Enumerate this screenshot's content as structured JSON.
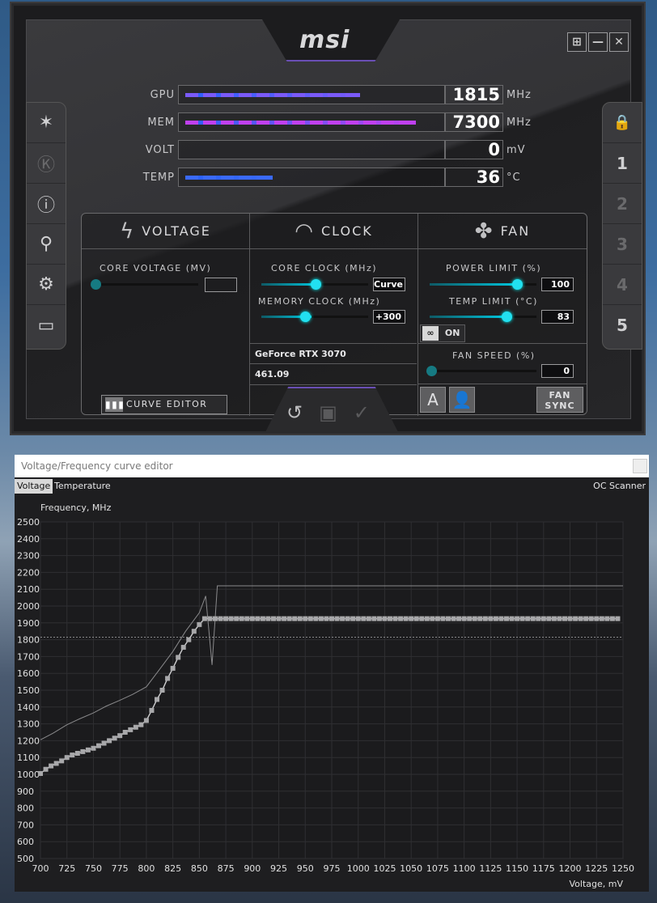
{
  "brand": "msi",
  "window_buttons": [
    "⊞",
    "—",
    "✕"
  ],
  "left_sidebar": [
    {
      "icon": "afterburner-icon",
      "glyph": "✶"
    },
    {
      "icon": "kombustor-icon",
      "glyph": "Ⓚ"
    },
    {
      "icon": "info-icon",
      "glyph": "ⓘ"
    },
    {
      "icon": "oc-scanner-icon",
      "glyph": "⚲"
    },
    {
      "icon": "settings-gear-icon",
      "glyph": "⚙"
    },
    {
      "icon": "monitor-icon",
      "glyph": "▭"
    }
  ],
  "right_sidebar": [
    {
      "icon": "lock-icon",
      "label": "🔒"
    },
    {
      "label": "1",
      "active": true
    },
    {
      "label": "2",
      "active": false
    },
    {
      "label": "3",
      "active": false
    },
    {
      "label": "4",
      "active": false
    },
    {
      "label": "5",
      "active": true
    }
  ],
  "meters": {
    "gpu": {
      "label": "GPU",
      "value": "1815",
      "unit": "MHz",
      "fill": 0.72,
      "color": "#7a5af8"
    },
    "mem": {
      "label": "MEM",
      "value": "7300",
      "unit": "MHz",
      "fill": 0.95,
      "color": "#c040f0"
    },
    "volt": {
      "label": "VOLT",
      "value": "0",
      "unit": "mV",
      "fill": 0.0,
      "color": "#3a8aff"
    },
    "temp": {
      "label": "TEMP",
      "value": "36",
      "unit": "°C",
      "fill": 0.36,
      "color": "#3a6aff"
    }
  },
  "voltage_panel": {
    "title": "VOLTAGE",
    "core_voltage_label": "CORE VOLTAGE  (MV)",
    "core_voltage_value": "",
    "curve_editor_label": "CURVE EDITOR"
  },
  "clock_panel": {
    "title": "CLOCK",
    "core_clock_label": "CORE CLOCK (MHz)",
    "core_clock_value": "Curve",
    "memory_clock_label": "MEMORY CLOCK (MHz)",
    "memory_clock_value": "+300",
    "gpu_name": "GeForce RTX 3070",
    "driver_version": "461.09"
  },
  "fan_panel": {
    "title": "FAN",
    "power_limit_label": "POWER LIMIT (%)",
    "power_limit_value": "100",
    "temp_limit_label": "TEMP LIMIT (°C)",
    "temp_limit_value": "83",
    "link_toggle_label": "ON",
    "fan_speed_label": "FAN SPEED (%)",
    "fan_speed_value": "0",
    "auto_label": "A",
    "fan_sync_label": "FAN\nSYNC"
  },
  "bottom_actions": [
    {
      "icon": "reset-icon",
      "glyph": "↺"
    },
    {
      "icon": "save-icon",
      "glyph": "▣"
    },
    {
      "icon": "apply-check-icon",
      "glyph": "✓"
    }
  ],
  "vf_editor": {
    "title": "Voltage/Frequency curve editor",
    "tabs": [
      "Voltage",
      "Temperature"
    ],
    "oc_scanner": "OC Scanner"
  },
  "chart_data": {
    "type": "line",
    "ylabel": "Frequency, MHz",
    "xlabel": "Voltage, mV",
    "xlim": [
      700,
      1250
    ],
    "ylim": [
      500,
      2500
    ],
    "x_ticks": [
      700,
      725,
      750,
      775,
      800,
      825,
      850,
      875,
      900,
      925,
      950,
      975,
      1000,
      1025,
      1050,
      1075,
      1100,
      1125,
      1150,
      1175,
      1200,
      1225,
      1250
    ],
    "y_ticks": [
      500,
      600,
      700,
      800,
      900,
      1000,
      1100,
      1200,
      1300,
      1400,
      1500,
      1600,
      1700,
      1800,
      1900,
      2000,
      2100,
      2200,
      2300,
      2400,
      2500
    ],
    "reference_line": 1815,
    "grid": true,
    "series": [
      {
        "role": "default-curve",
        "x": [
          700,
          712,
          725,
          737,
          750,
          762,
          775,
          787,
          800,
          812,
          825,
          837,
          850,
          856,
          862,
          867,
          1250
        ],
        "y": [
          1205,
          1245,
          1295,
          1330,
          1365,
          1405,
          1440,
          1475,
          1520,
          1620,
          1730,
          1850,
          1960,
          2060,
          1650,
          2120,
          2120
        ]
      },
      {
        "role": "current-curve",
        "x": [
          700,
          705,
          710,
          715,
          720,
          725,
          730,
          735,
          740,
          745,
          750,
          755,
          760,
          765,
          770,
          775,
          780,
          785,
          790,
          795,
          800,
          805,
          810,
          815,
          820,
          825,
          830,
          835,
          840,
          845,
          850,
          855,
          860,
          865,
          870,
          875,
          880,
          885,
          890,
          895,
          900,
          905,
          910,
          915,
          920,
          925,
          930,
          935,
          940,
          945,
          950,
          955,
          960,
          965,
          970,
          975,
          980,
          985,
          990,
          995,
          1000,
          1005,
          1010,
          1015,
          1020,
          1025,
          1030,
          1035,
          1040,
          1045,
          1050,
          1055,
          1060,
          1065,
          1070,
          1075,
          1080,
          1085,
          1090,
          1095,
          1100,
          1105,
          1110,
          1115,
          1120,
          1125,
          1130,
          1135,
          1140,
          1145,
          1150,
          1155,
          1160,
          1165,
          1170,
          1175,
          1180,
          1185,
          1190,
          1195,
          1200,
          1205,
          1210,
          1215,
          1220,
          1225,
          1230,
          1235,
          1240,
          1245
        ],
        "y": [
          1005,
          1030,
          1050,
          1065,
          1080,
          1100,
          1115,
          1125,
          1135,
          1145,
          1155,
          1170,
          1185,
          1200,
          1215,
          1230,
          1250,
          1265,
          1280,
          1295,
          1320,
          1380,
          1445,
          1500,
          1570,
          1630,
          1695,
          1755,
          1800,
          1850,
          1890,
          1925,
          1925,
          1925,
          1925,
          1925,
          1925,
          1925,
          1925,
          1925,
          1925,
          1925,
          1925,
          1925,
          1925,
          1925,
          1925,
          1925,
          1925,
          1925,
          1925,
          1925,
          1925,
          1925,
          1925,
          1925,
          1925,
          1925,
          1925,
          1925,
          1925,
          1925,
          1925,
          1925,
          1925,
          1925,
          1925,
          1925,
          1925,
          1925,
          1925,
          1925,
          1925,
          1925,
          1925,
          1925,
          1925,
          1925,
          1925,
          1925,
          1925,
          1925,
          1925,
          1925,
          1925,
          1925,
          1925,
          1925,
          1925,
          1925,
          1925,
          1925,
          1925,
          1925,
          1925,
          1925,
          1925,
          1925,
          1925,
          1925,
          1925,
          1925,
          1925,
          1925,
          1925,
          1925,
          1925,
          1925,
          1925,
          1925
        ]
      }
    ]
  }
}
